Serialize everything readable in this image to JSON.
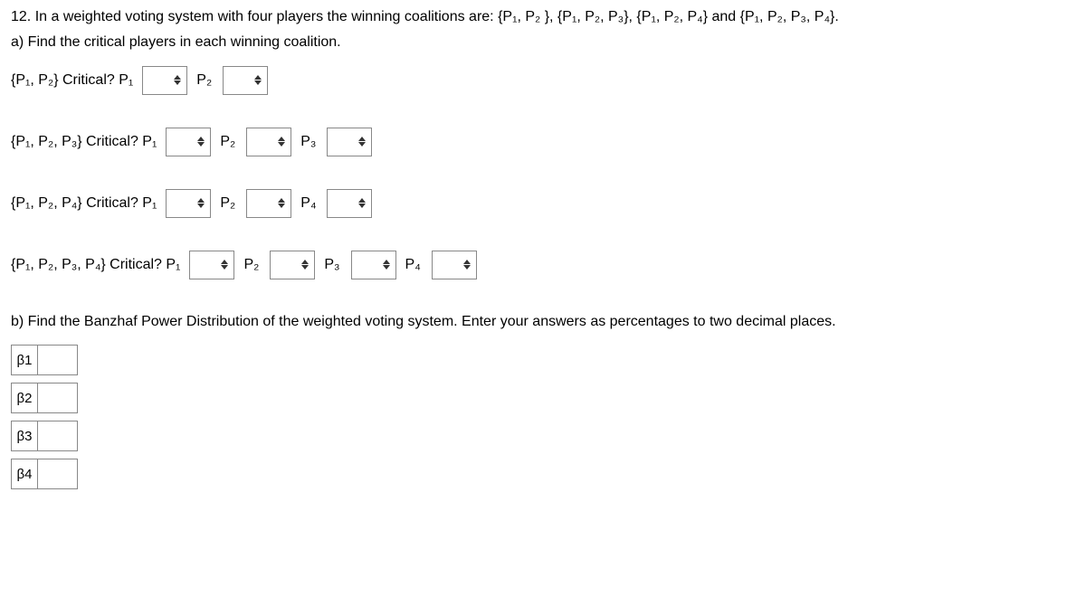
{
  "problem": "12. In a weighted voting system with four players the winning coalitions are:  {P₁, P₂ }, {P₁, P₂, P₃}, {P₁, P₂, P₄} and {P₁, P₂, P₃, P₄}.",
  "part_a": "a) Find the critical players in each winning coalition.",
  "rows": [
    {
      "coalition": "{P₁, P₂}  Critical?  P₁",
      "players": [
        "P₂"
      ]
    },
    {
      "coalition": "{P₁, P₂, P₃} Critical?  P₁",
      "players": [
        "P₂",
        "P₃"
      ]
    },
    {
      "coalition": "{P₁, P₂, P₄} Critical?  P₁",
      "players": [
        "P₂",
        "P₄"
      ]
    },
    {
      "coalition": "{P₁, P₂, P₃, P₄} Critical?  P₁",
      "players": [
        "P₂",
        "P₃",
        "P₄"
      ]
    }
  ],
  "part_b": "b) Find the Banzhaf Power Distribution of the weighted voting system. Enter your answers as percentages to two decimal places.",
  "betas": [
    "β1",
    "β2",
    "β3",
    "β4"
  ]
}
